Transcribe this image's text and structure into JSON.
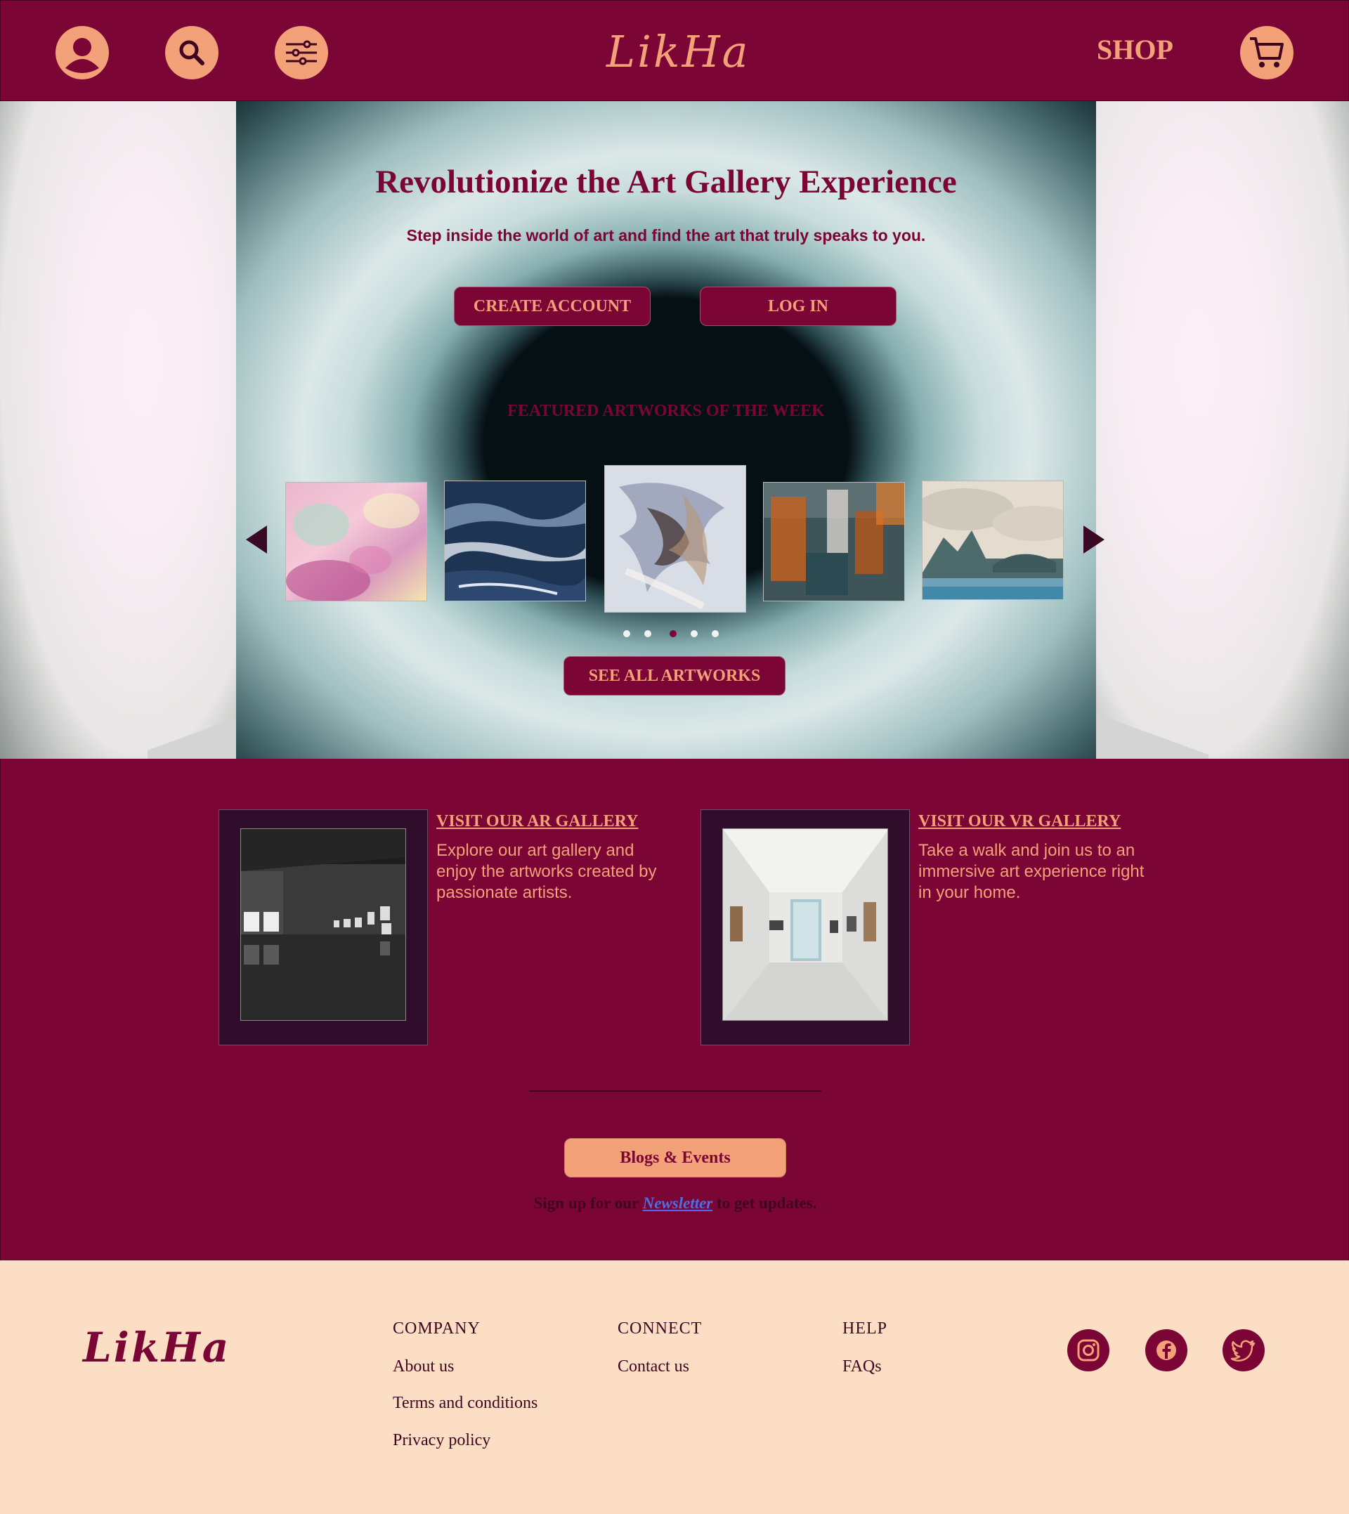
{
  "header": {
    "logo": "LikHa",
    "shop_label": "SHOP",
    "icons": [
      "user-icon",
      "search-icon",
      "filter-icon",
      "cart-icon"
    ]
  },
  "hero": {
    "title": "Revolutionize the Art Gallery Experience",
    "subtitle": "Step inside the world of art and find the art that truly speaks to you.",
    "create_account_label": "CREATE ACCOUNT",
    "login_label": "LOG IN",
    "featured_heading": "FEATURED ARTWORKS OF THE WEEK",
    "see_all_label": "SEE ALL ARTWORKS",
    "carousel_active_index": 2,
    "carousel_count": 5
  },
  "galleries": {
    "ar": {
      "title": "VISIT OUR AR GALLERY",
      "description": "Explore our art gallery and enjoy the artworks created by passionate artists."
    },
    "vr": {
      "title": "VISIT OUR VR GALLERY",
      "description": "Take a walk and join us to an immersive art experience right in your home."
    }
  },
  "blogs_label": "Blogs & Events",
  "newsletter": {
    "prefix": "Sign up for our",
    "link": "Newsletter",
    "suffix": "to get updates."
  },
  "footer": {
    "logo": "LikHa",
    "company": {
      "heading": "COMPANY",
      "links": [
        "About us",
        "Terms and conditions",
        "Privacy policy"
      ]
    },
    "connect": {
      "heading": "CONNECT",
      "links": [
        "Contact us"
      ]
    },
    "help": {
      "heading": "HELP",
      "links": [
        "FAQs"
      ]
    },
    "social": [
      "instagram-icon",
      "facebook-icon",
      "twitter-icon"
    ]
  },
  "colors": {
    "brand": "#7b0534",
    "accent": "#f3a179",
    "footer_bg": "#fcdec5",
    "link": "#4d6ee6"
  }
}
